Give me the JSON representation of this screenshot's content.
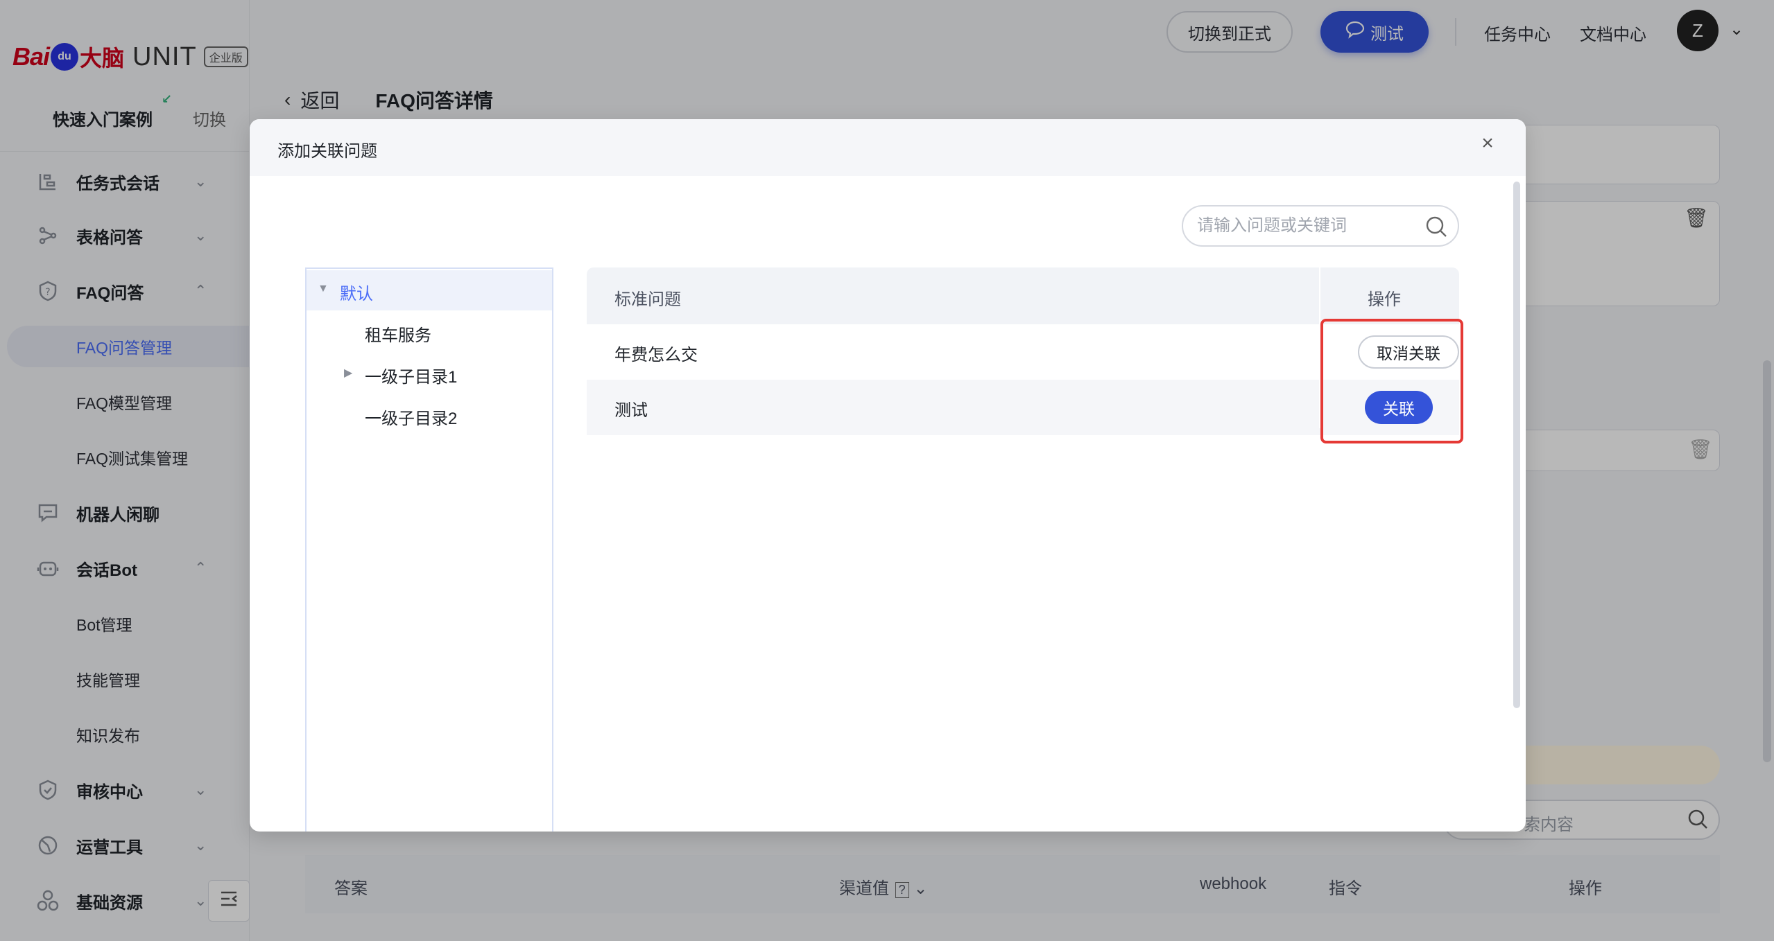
{
  "brand": {
    "bai": "Bai",
    "paw": "du",
    "danao": "大脑",
    "unit": "UNIT",
    "edition": "企业版"
  },
  "sidebar": {
    "quick_start": "快速入门案例",
    "switch": "切换",
    "groups": [
      {
        "label": "任务式会话",
        "icon": "dialog-flow-icon",
        "expanded": false
      },
      {
        "label": "表格问答",
        "icon": "table-qa-icon",
        "expanded": false
      },
      {
        "label": "FAQ问答",
        "icon": "faq-icon",
        "expanded": true,
        "items": [
          "FAQ问答管理",
          "FAQ模型管理",
          "FAQ测试集管理"
        ],
        "active": "FAQ问答管理"
      },
      {
        "label": "机器人闲聊",
        "icon": "chat-bot-icon"
      },
      {
        "label": "会话Bot",
        "icon": "bot-icon",
        "expanded": true,
        "items": [
          "Bot管理",
          "技能管理",
          "知识发布"
        ]
      },
      {
        "label": "审核中心",
        "icon": "shield-icon",
        "expanded": false
      },
      {
        "label": "运营工具",
        "icon": "ops-tool-icon",
        "expanded": false
      },
      {
        "label": "基础资源",
        "icon": "resource-icon",
        "expanded": false
      }
    ]
  },
  "topbar": {
    "switch_formal": "切换到正式",
    "test": "测试",
    "task_center": "任务中心",
    "doc_center": "文档中心",
    "avatar_letter": "Z"
  },
  "page": {
    "back": "返回",
    "title": "FAQ问答详情"
  },
  "background": {
    "search_placeholder": "索内容",
    "table_headers": [
      "答案",
      "渠道值",
      "webhook",
      "指令",
      "操作"
    ],
    "help_mark": "?"
  },
  "modal": {
    "title": "添加关联问题",
    "search_placeholder": "请输入问题或关键词",
    "tree": [
      {
        "label": "默认",
        "selected": true,
        "expanded": true
      },
      {
        "label": "租车服务"
      },
      {
        "label": "一级子目录1",
        "has_children": true
      },
      {
        "label": "一级子目录2"
      }
    ],
    "table": {
      "headers": {
        "question": "标准问题",
        "action": "操作"
      },
      "rows": [
        {
          "question": "年费怎么交",
          "action": "取消关联",
          "linked": true
        },
        {
          "question": "测试",
          "action": "关联",
          "linked": false
        }
      ]
    }
  },
  "colors": {
    "primary": "#3453d9",
    "active_text": "#4a6cf7",
    "highlight": "#e53935"
  }
}
